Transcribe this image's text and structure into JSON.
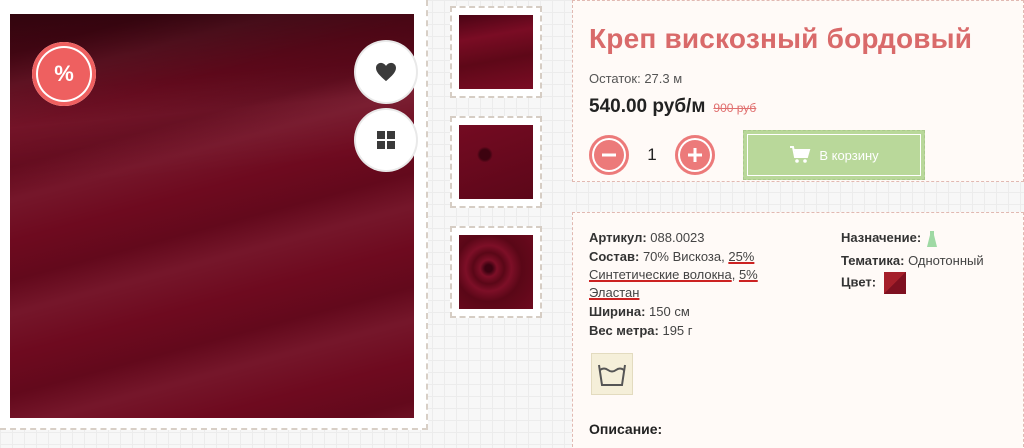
{
  "product": {
    "title": "Креп вискозный бордовый",
    "stock": "Остаток: 27.3 м",
    "price": "540.00 руб/м",
    "old_price": "900 руб",
    "quantity": "1",
    "cart_label": "В корзину",
    "sale_badge": "%"
  },
  "specs": {
    "article_label": "Артикул:",
    "article_value": "088.0023",
    "composition_label": "Состав:",
    "composition_part1": "70% Вискоза, ",
    "composition_part2": "25% Синтетические волокна",
    "composition_sep": ", ",
    "composition_part3": "5% Эластан",
    "width_label": "Ширина:",
    "width_value": "150 см",
    "weight_label": "Вес метра:",
    "weight_value": "195 г",
    "purpose_label": "Назначение:",
    "theme_label": "Тематика:",
    "theme_value": "Однотонный",
    "color_label": "Цвет:"
  },
  "description_title": "Описание:",
  "colors": {
    "fabric": "#6e0a1f",
    "accent": "#d96a6a",
    "cart_button": "#b9d89a",
    "sale": "#ee6060"
  },
  "icons": [
    "heart-icon",
    "grid-icon",
    "cart-icon",
    "minus-icon",
    "plus-icon",
    "dress-icon",
    "wash-icon"
  ]
}
